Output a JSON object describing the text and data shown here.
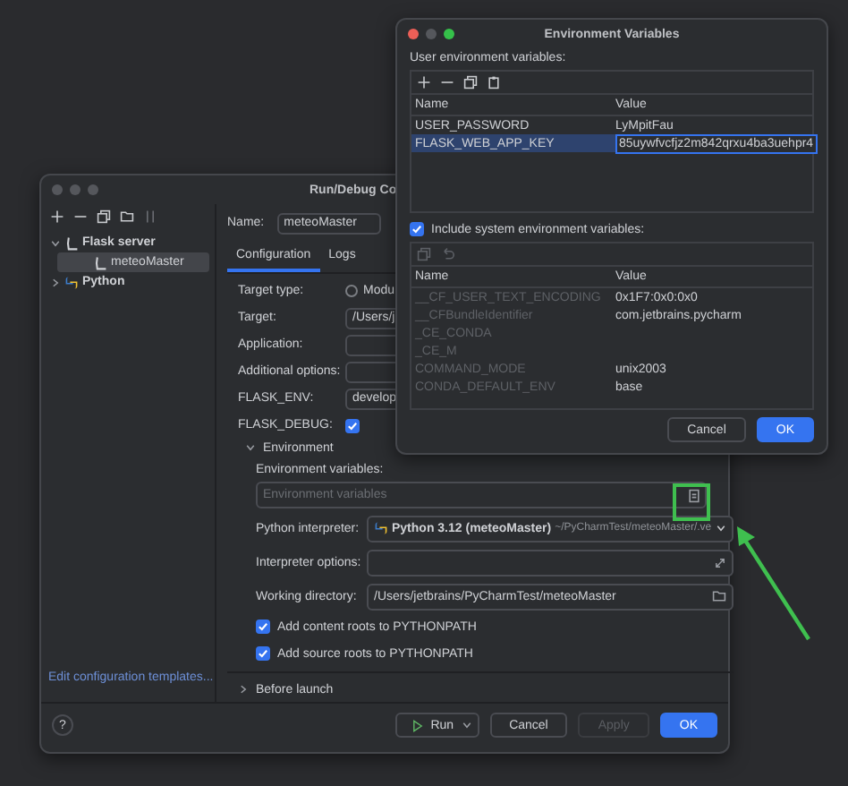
{
  "run_debug_window": {
    "title": "Run/Debug Co",
    "tree": [
      {
        "label": "Flask server",
        "kind": "flask",
        "expanded": true,
        "selected": false,
        "children": [
          {
            "label": "meteoMaster",
            "kind": "flask",
            "selected": true
          }
        ]
      },
      {
        "label": "Python",
        "kind": "python",
        "expanded": false,
        "selected": false
      }
    ],
    "templates_link": "Edit configuration templates...",
    "name_label": "Name:",
    "name_value": "meteoMaster",
    "tabs": [
      {
        "label": "Configuration",
        "selected": true
      },
      {
        "label": "Logs",
        "selected": false
      }
    ],
    "form": [
      {
        "kind": "radio",
        "label": "Target type:",
        "value": "Modu",
        "checked": false
      },
      {
        "kind": "field",
        "label": "Target:",
        "value": "/Users/j"
      },
      {
        "kind": "field",
        "label": "Application:"
      },
      {
        "kind": "field",
        "label": "Additional options:"
      },
      {
        "kind": "field",
        "label": "FLASK_ENV:",
        "value": "develop"
      },
      {
        "kind": "checkbox",
        "label": "FLASK_DEBUG:",
        "checked": true
      }
    ],
    "environment": {
      "label": "Environment",
      "expanded": true,
      "env_vars_label": "Environment variables:",
      "env_vars_placeholder": "Environment variables",
      "interpreter_label": "Python interpreter:",
      "interpreter_name": "Python 3.12 (meteoMaster)",
      "interpreter_path": "~/PyCharmTest/meteoMaster/.ve",
      "interpreter_options_label": "Interpreter options:",
      "working_dir_label": "Working directory:",
      "working_dir_value": "/Users/jetbrains/PyCharmTest/meteoMaster",
      "options": [
        {
          "label": "Add content roots to PYTHONPATH",
          "checked": true
        },
        {
          "label": "Add source roots to PYTHONPATH",
          "checked": true
        }
      ]
    },
    "before_launch": {
      "label": "Before launch",
      "expanded": false
    },
    "buttons": [
      {
        "kind": "help",
        "label": "?",
        "disabled": false
      },
      {
        "kind": "run",
        "label": "Run",
        "disabled": false
      },
      {
        "kind": "cancel",
        "label": "Cancel",
        "disabled": false
      },
      {
        "kind": "apply",
        "label": "Apply",
        "disabled": true
      },
      {
        "kind": "ok",
        "label": "OK",
        "disabled": false
      }
    ]
  },
  "env_dialog": {
    "title": "Environment Variables",
    "user_label": "User environment variables:",
    "user_columns": [
      "Name",
      "Value"
    ],
    "user_rows": [
      {
        "name": "USER_PASSWORD",
        "value": "LyMpitFau",
        "selected": false
      },
      {
        "name": "FLASK_WEB_APP_KEY",
        "value": "85uywfvcfjz2m842qrxu4ba3uehpr4",
        "selected": true
      }
    ],
    "include_system": {
      "label": "Include system environment variables:",
      "checked": true
    },
    "system_columns": [
      "Name",
      "Value"
    ],
    "system_rows": [
      {
        "name": "__CF_USER_TEXT_ENCODING",
        "value": "0x1F7:0x0:0x0"
      },
      {
        "name": "__CFBundleIdentifier",
        "value": "com.jetbrains.pycharm"
      },
      {
        "name": "_CE_CONDA"
      },
      {
        "name": "_CE_M"
      },
      {
        "name": "COMMAND_MODE",
        "value": "unix2003"
      },
      {
        "name": "CONDA_DEFAULT_ENV",
        "value": "base"
      }
    ],
    "buttons": [
      {
        "kind": "cancel",
        "label": "Cancel"
      },
      {
        "kind": "ok",
        "label": "OK"
      }
    ]
  }
}
